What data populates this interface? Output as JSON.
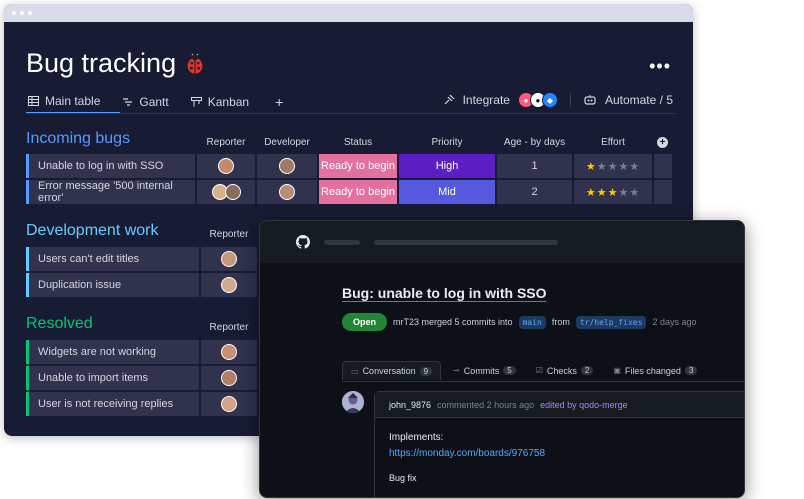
{
  "board": {
    "title": "Bug tracking",
    "tabs": [
      {
        "label": "Main table",
        "icon": "table-icon"
      },
      {
        "label": "Gantt",
        "icon": "gantt-icon"
      },
      {
        "label": "Kanban",
        "icon": "kanban-icon"
      }
    ],
    "add_view": "+",
    "integrate_label": "Integrate",
    "automate_label": "Automate / 5",
    "more": "•••",
    "columns": [
      "Reporter",
      "Developer",
      "Status",
      "Priority",
      "Age - by days",
      "Effort"
    ],
    "groups": [
      {
        "title": "Incoming bugs",
        "color": "#579bfc",
        "rows": [
          {
            "name": "Unable to log in with SSO",
            "status": "Ready to begin",
            "priority": "High",
            "age": "1",
            "effort": 1
          },
          {
            "name": "Error message '500 internal error'",
            "status": "Ready to begin",
            "priority": "Mid",
            "age": "2",
            "effort": 3
          }
        ]
      },
      {
        "title": "Development work",
        "color": "#66ccff",
        "rows": [
          {
            "name": "Users can't edit titles"
          },
          {
            "name": "Duplication issue"
          }
        ]
      },
      {
        "title": "Resolved",
        "color": "#00c875",
        "rows": [
          {
            "name": "Widgets are not working"
          },
          {
            "name": "Unable to import items"
          },
          {
            "name": "User is not receiving replies"
          }
        ]
      }
    ],
    "colors": {
      "status_ready": "#e2719f",
      "priority_high": "#5a1ec3",
      "priority_mid": "#5559df"
    }
  },
  "github": {
    "pr_title": "Bug: unable to log in with SSO",
    "state": "Open",
    "merge_text": "mrT23 merged 5 commits into",
    "base_branch": "main",
    "from_text": "from",
    "head_branch": "tr/help_fixes",
    "time_ago": "2 days ago",
    "tabs": [
      {
        "label": "Conversation",
        "count": "9",
        "icon": "conversation-icon"
      },
      {
        "label": "Commits",
        "count": "5",
        "icon": "commit-icon"
      },
      {
        "label": "Checks",
        "count": "2",
        "icon": "checks-icon"
      },
      {
        "label": "Files changed",
        "count": "3",
        "icon": "files-icon"
      }
    ],
    "comment": {
      "user": "john_9876",
      "commented": "commented 2 hours ago",
      "edited": "edited by qodo-merge",
      "heading": "Implements:",
      "link": "https://monday.com/boards/976758",
      "body": "Bug fix"
    }
  }
}
